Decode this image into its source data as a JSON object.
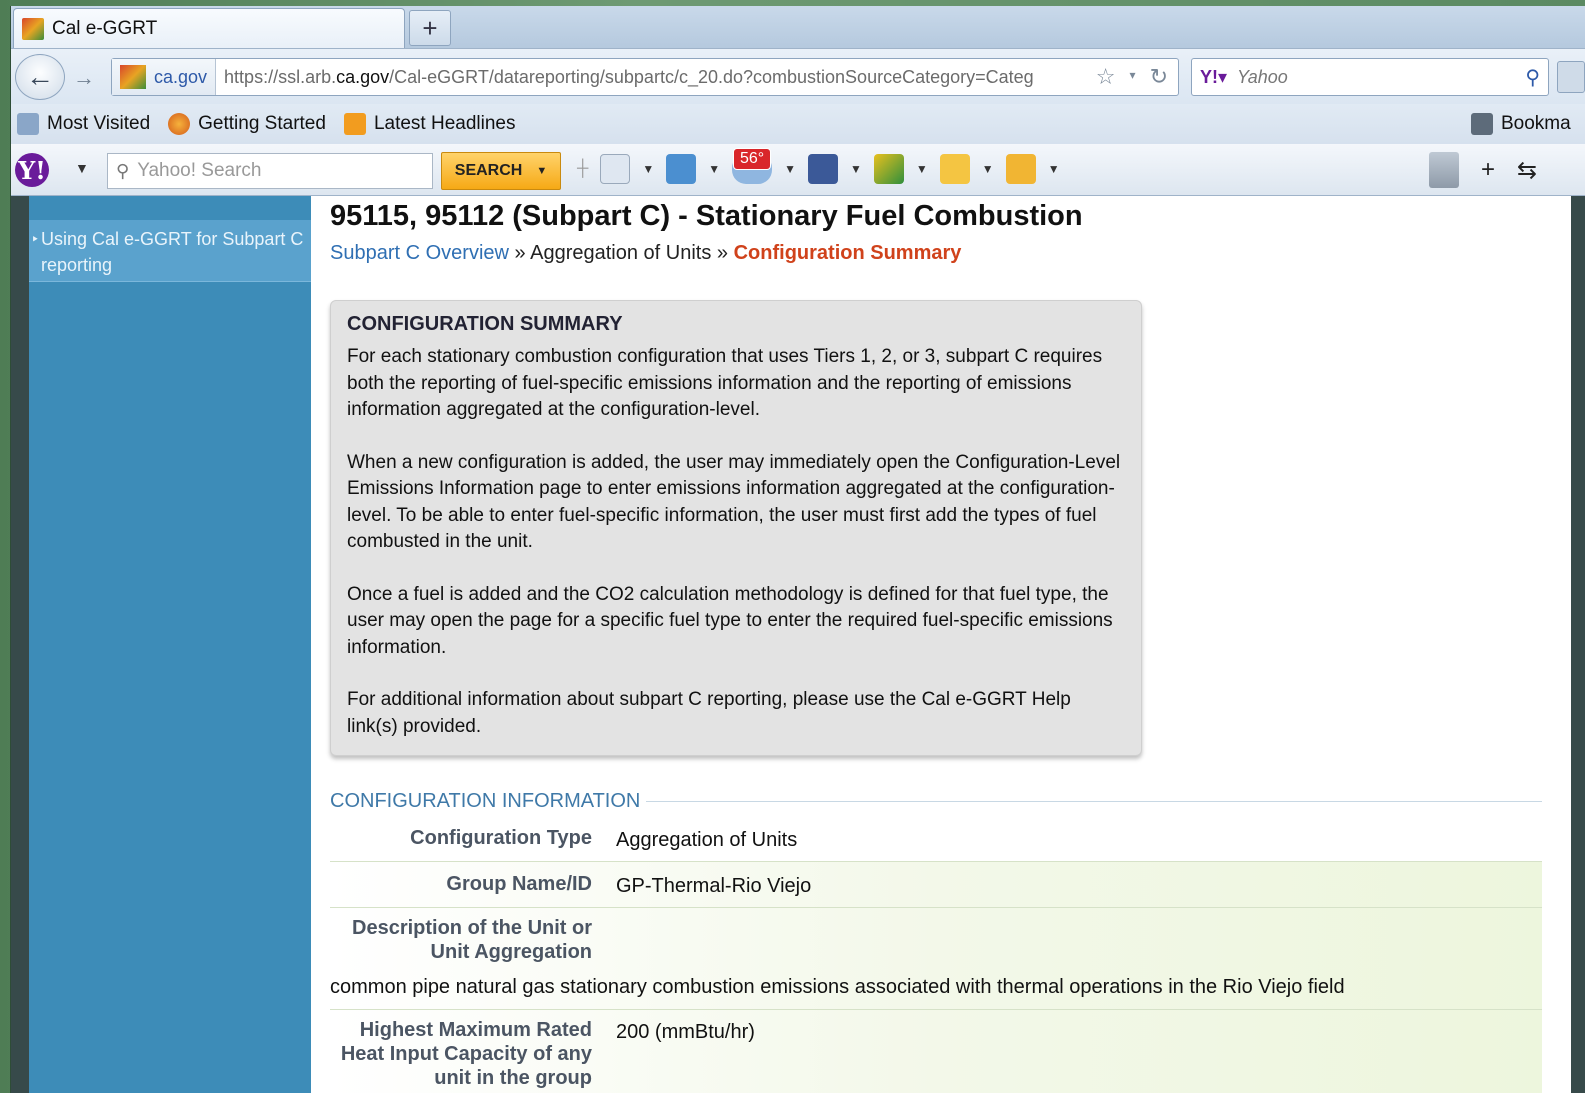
{
  "browser": {
    "tab_title": "Cal e-GGRT",
    "new_tab_label": "+",
    "site_identity": "ca.gov",
    "url_prefix": "https://ssl.arb.",
    "url_domain": "ca.gov",
    "url_suffix": "/Cal-eGGRT/datareporting/subpartc/c_20.do?combustionSourceCategory=Categ",
    "search_engine_placeholder": "Yahoo"
  },
  "bookmarks": {
    "items": [
      "Most Visited",
      "Getting Started",
      "Latest Headlines"
    ],
    "right_label": "Bookma"
  },
  "yahoo_toolbar": {
    "logo": "Y!",
    "search_placeholder": "Yahoo! Search",
    "search_button": "SEARCH",
    "weather_badge": "56°"
  },
  "sidebar": {
    "items": [
      {
        "label": "Using Cal e-GGRT for Subpart C reporting"
      }
    ]
  },
  "main": {
    "title": "95115, 95112 (Subpart C) - Stationary Fuel Combustion",
    "breadcrumb": {
      "link": "Subpart C Overview",
      "sep": "»",
      "middle": "Aggregation of Units",
      "active": "Configuration Summary"
    },
    "summary": {
      "heading": "CONFIGURATION SUMMARY",
      "paragraphs": [
        "For each stationary combustion configuration that uses Tiers 1, 2, or 3, subpart C requires both the reporting of fuel-specific emissions information and the reporting of emissions information aggregated at the configuration-level.",
        "When a new configuration is added, the user may immediately open the Configuration-Level Emissions Information page to enter emissions information aggregated at the configuration-level. To be able to enter fuel-specific information, the user must first add the types of fuel combusted in the unit.",
        "Once a fuel is added and the CO2 calculation methodology is defined for that fuel type, the user may open the page for a specific fuel type to enter the required fuel-specific emissions information.",
        "For additional information about subpart C reporting, please use the Cal e-GGRT Help link(s) provided."
      ]
    },
    "config_info": {
      "title": "CONFIGURATION INFORMATION",
      "rows": [
        {
          "label": "Configuration Type",
          "value": "Aggregation of Units"
        },
        {
          "label": "Group Name/ID",
          "value": "GP-Thermal-Rio Viejo"
        },
        {
          "label": "Description of the Unit or Unit Aggregation",
          "value": "common pipe natural gas stationary combustion emissions associated with thermal operations in the Rio Viejo field"
        },
        {
          "label": "Highest Maximum Rated Heat Input Capacity of any unit in the group",
          "value": "200 (mmBtu/hr)"
        }
      ]
    }
  }
}
